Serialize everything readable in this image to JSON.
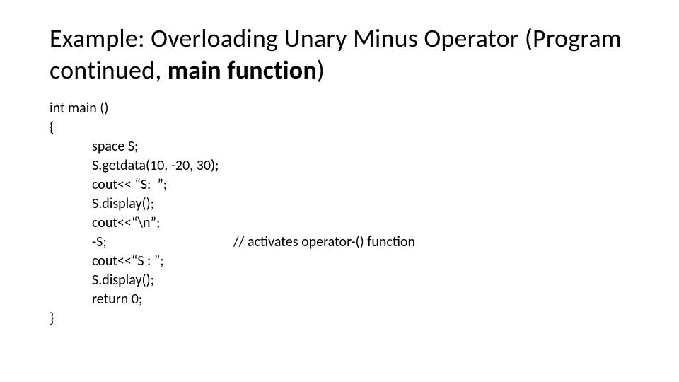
{
  "title": {
    "plain1": "Example: Overloading Unary Minus Operator (Program continued, ",
    "bold": "main function",
    "plain2": ")"
  },
  "code": {
    "l1": "int main ()",
    "l2": "{",
    "l3": "space S;",
    "l4": "S.getdata(10, -20, 30);",
    "l5": "cout<< “S:  ”;",
    "l6": "S.display();",
    "l7": "cout<<“\\n”;",
    "l8_stmt": "-S;",
    "l8_comment": "// activates operator-() function",
    "l9": "cout<<“S : ”;",
    "l10": "S.display();",
    "l11": "return 0;",
    "l12": "}"
  }
}
